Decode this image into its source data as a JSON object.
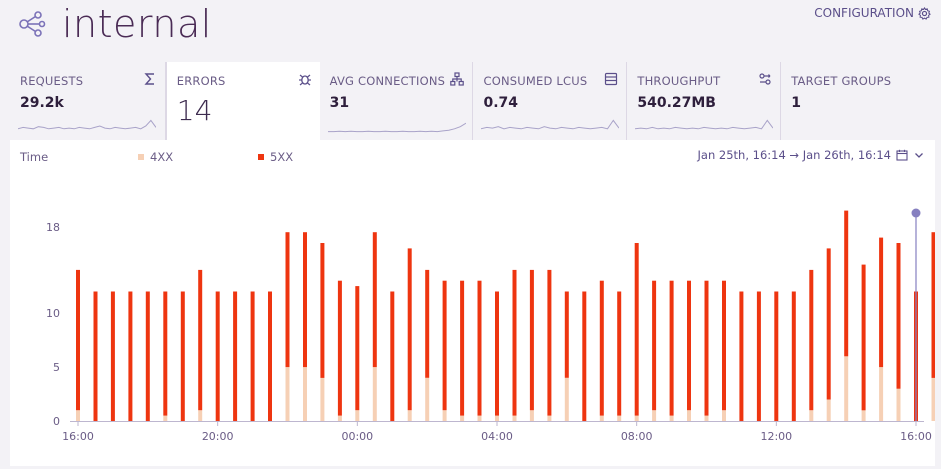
{
  "header": {
    "title": "internal",
    "config_label": "CONFIGURATION",
    "logo_icon": "share-nodes-icon",
    "config_icon": "gear-icon"
  },
  "metrics": [
    {
      "label": "REQUESTS",
      "value": "29.2k",
      "icon": "sigma-icon",
      "spark": [
        0.3,
        0.4,
        0.35,
        0.3,
        0.45,
        0.4,
        0.3,
        0.35,
        0.4,
        0.3,
        0.35,
        0.3,
        0.4,
        0.35,
        0.3,
        0.4,
        0.5,
        0.35,
        0.3,
        0.4,
        0.35,
        0.3,
        0.35,
        0.4,
        0.3,
        0.5,
        0.9,
        0.4
      ]
    },
    {
      "label": "ERRORS",
      "value": "14",
      "icon": "bug-icon",
      "active": true
    },
    {
      "label": "AVG CONNECTIONS",
      "value": "31",
      "icon": "network-icon",
      "spark": [
        0.1,
        0.1,
        0.12,
        0.1,
        0.12,
        0.1,
        0.1,
        0.12,
        0.1,
        0.1,
        0.12,
        0.1,
        0.1,
        0.12,
        0.1,
        0.1,
        0.12,
        0.1,
        0.12,
        0.1,
        0.15,
        0.2,
        0.3,
        0.45,
        0.7
      ]
    },
    {
      "label": "CONSUMED LCUS",
      "value": "0.74",
      "icon": "database-icon",
      "spark": [
        0.3,
        0.4,
        0.35,
        0.45,
        0.3,
        0.4,
        0.35,
        0.3,
        0.4,
        0.35,
        0.3,
        0.45,
        0.35,
        0.3,
        0.4,
        0.35,
        0.3,
        0.4,
        0.35,
        0.3,
        0.35,
        0.4,
        0.3,
        0.9,
        0.35
      ]
    },
    {
      "label": "THROUGHPUT",
      "value": "540.27MB",
      "icon": "flow-icon",
      "spark": [
        0.3,
        0.35,
        0.3,
        0.4,
        0.3,
        0.35,
        0.3,
        0.4,
        0.35,
        0.3,
        0.35,
        0.3,
        0.4,
        0.35,
        0.3,
        0.35,
        0.3,
        0.4,
        0.35,
        0.3,
        0.35,
        0.4,
        0.3,
        0.9,
        0.35
      ]
    },
    {
      "label": "TARGET GROUPS",
      "value": "1",
      "icon": ""
    }
  ],
  "chart_header": {
    "time_label": "Time",
    "range_label": "Jan 25th, 16:14 → Jan 26th, 16:14",
    "calendar_icon": "calendar-icon",
    "chevron_icon": "chevron-down-icon"
  },
  "colors": {
    "4xx": "#f6d0b5",
    "5xx": "#ee3510",
    "cursor": "#8680c0",
    "accent": "#5b4f8a"
  },
  "chart_data": {
    "type": "bar",
    "stacked": true,
    "xlabel": "",
    "ylabel": "",
    "ylim": [
      0,
      19
    ],
    "y_ticks": [
      0,
      5,
      10,
      18
    ],
    "x_ticks": [
      "16:00",
      "20:00",
      "00:00",
      "04:00",
      "08:00",
      "12:00",
      "16:00"
    ],
    "x_range_hours": [
      0,
      24
    ],
    "bar_interval_hours": 0.5,
    "legend_placement": "top-left",
    "grid": false,
    "series": [
      {
        "name": "4XX",
        "color": "#f6d0b5",
        "values": [
          1,
          0,
          0,
          0,
          0,
          0.5,
          0,
          1,
          0,
          0,
          0,
          0,
          5,
          5,
          4,
          0.5,
          1,
          5,
          0,
          1,
          4,
          1,
          0.5,
          0.5,
          0.5,
          0.5,
          1,
          0.5,
          4,
          0,
          0.5,
          0.5,
          0.5,
          1,
          0.5,
          1,
          0.5,
          1,
          0,
          0,
          0,
          0,
          1,
          2,
          6,
          1,
          5,
          3,
          0,
          4,
          0
        ]
      },
      {
        "name": "5XX",
        "color": "#ee3510",
        "values": [
          13,
          12,
          12,
          12,
          12,
          11.5,
          12,
          13,
          12,
          12,
          12,
          12,
          12.5,
          12.5,
          12.5,
          12.5,
          11.5,
          12.5,
          12,
          15,
          10,
          12,
          12.5,
          12.5,
          11.5,
          13.5,
          13,
          13.5,
          8,
          12,
          12.5,
          11.5,
          16,
          12,
          12.5,
          12,
          12.5,
          12,
          12,
          12,
          12,
          12,
          13,
          14,
          13.5,
          13.5,
          12,
          13.5,
          12,
          13.5,
          6
        ]
      }
    ],
    "cursor_at_hour": 24
  }
}
